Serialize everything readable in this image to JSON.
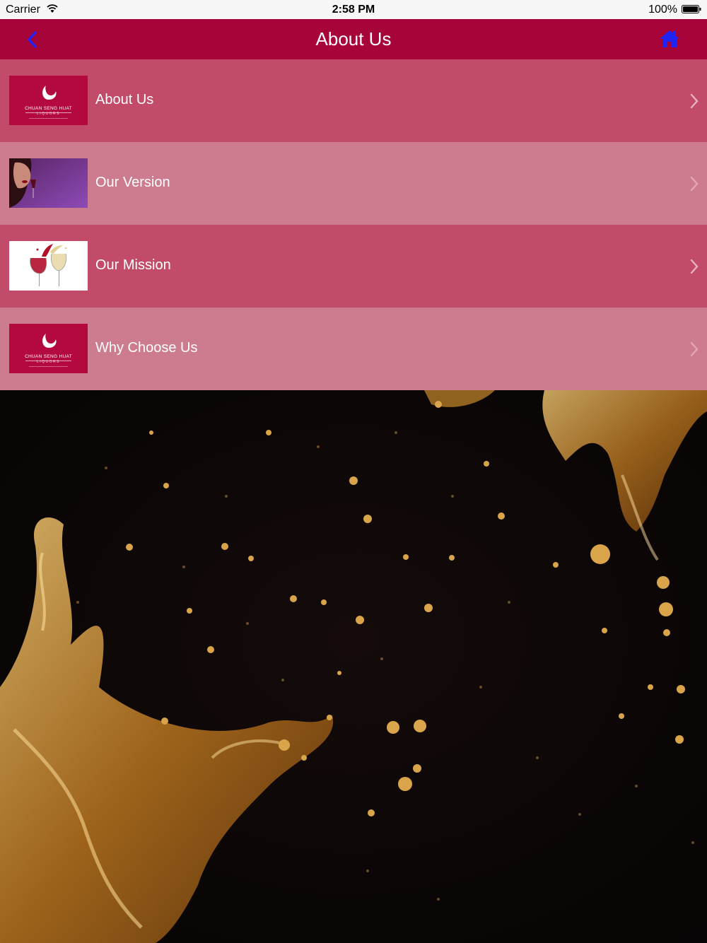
{
  "status_bar": {
    "carrier": "Carrier",
    "time": "2:58 PM",
    "battery": "100%"
  },
  "nav": {
    "title": "About Us",
    "back_icon": "chevron-left-icon",
    "home_icon": "home-icon",
    "icon_color": "#1f23f5",
    "bar_color": "#a7043a"
  },
  "menu": {
    "items": [
      {
        "label": "About Us",
        "thumb": "brand-logo",
        "logo_line1": "CHUAN SENG HUAT",
        "logo_line2": "LIQUORS"
      },
      {
        "label": "Our Version",
        "thumb": "woman-with-wine-photo"
      },
      {
        "label": "Our Mission",
        "thumb": "wine-glasses-splash-photo"
      },
      {
        "label": "Why Choose Us",
        "thumb": "brand-logo",
        "logo_line1": "CHUAN SENG HUAT",
        "logo_line2": "LIQUORS"
      }
    ],
    "row_colors": [
      "#c14b68",
      "#cd7b8e"
    ]
  },
  "background": {
    "image": "liquor-splash-on-black"
  }
}
